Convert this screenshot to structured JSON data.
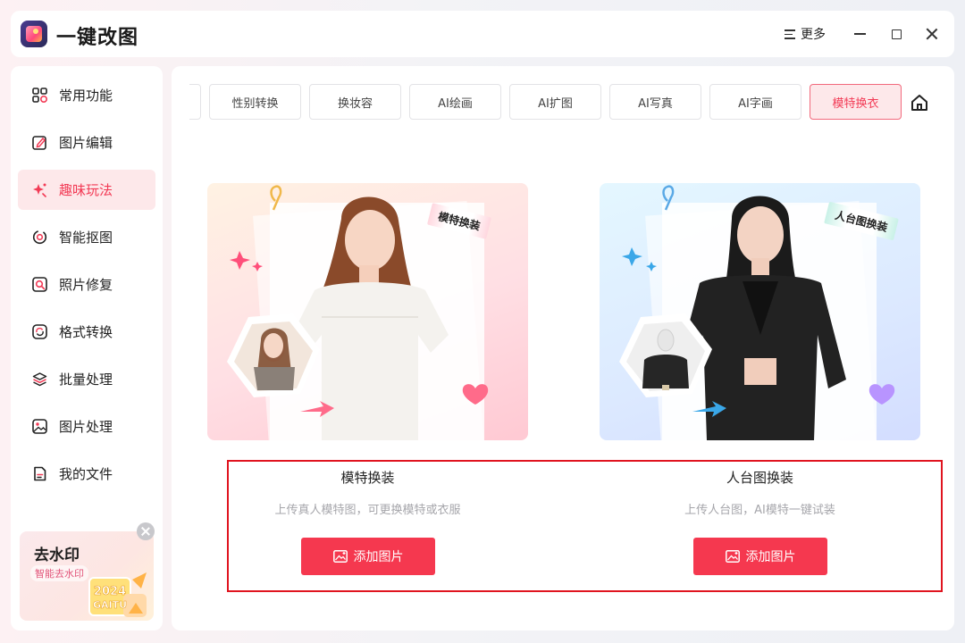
{
  "app": {
    "title": "一键改图",
    "more_label": "更多"
  },
  "sidebar": {
    "items": [
      {
        "label": "常用功能",
        "icon": "grid-icon",
        "active": false
      },
      {
        "label": "图片编辑",
        "icon": "edit-icon",
        "active": false
      },
      {
        "label": "趣味玩法",
        "icon": "sparkle-icon",
        "active": true
      },
      {
        "label": "智能抠图",
        "icon": "target-icon",
        "active": false
      },
      {
        "label": "照片修复",
        "icon": "repair-icon",
        "active": false
      },
      {
        "label": "格式转换",
        "icon": "convert-icon",
        "active": false
      },
      {
        "label": "批量处理",
        "icon": "layers-icon",
        "active": false
      },
      {
        "label": "图片处理",
        "icon": "image-icon",
        "active": false
      },
      {
        "label": "我的文件",
        "icon": "file-icon",
        "active": false
      }
    ],
    "promo": {
      "title": "去水印",
      "subtitle": "智能去水印",
      "badge_year": "2024",
      "badge_text": "GAITU"
    }
  },
  "tabs": [
    {
      "label": "",
      "active": false
    },
    {
      "label": "性别转换",
      "active": false
    },
    {
      "label": "换妆容",
      "active": false
    },
    {
      "label": "AI绘画",
      "active": false
    },
    {
      "label": "AI扩图",
      "active": false
    },
    {
      "label": "AI写真",
      "active": false
    },
    {
      "label": "AI字画",
      "active": false
    },
    {
      "label": "模特换衣",
      "active": true
    }
  ],
  "cards": [
    {
      "tag": "模特换装",
      "title": "模特换装",
      "description": "上传真人模特图，可更换模特或衣服",
      "button_label": "添加图片"
    },
    {
      "tag": "人台图换装",
      "title": "人台图换装",
      "description": "上传人台图，AI模特一键试装",
      "button_label": "添加图片"
    }
  ],
  "colors": {
    "accent": "#f5384f",
    "active_bg": "#fde8ea",
    "highlight_border": "#e0141f"
  }
}
